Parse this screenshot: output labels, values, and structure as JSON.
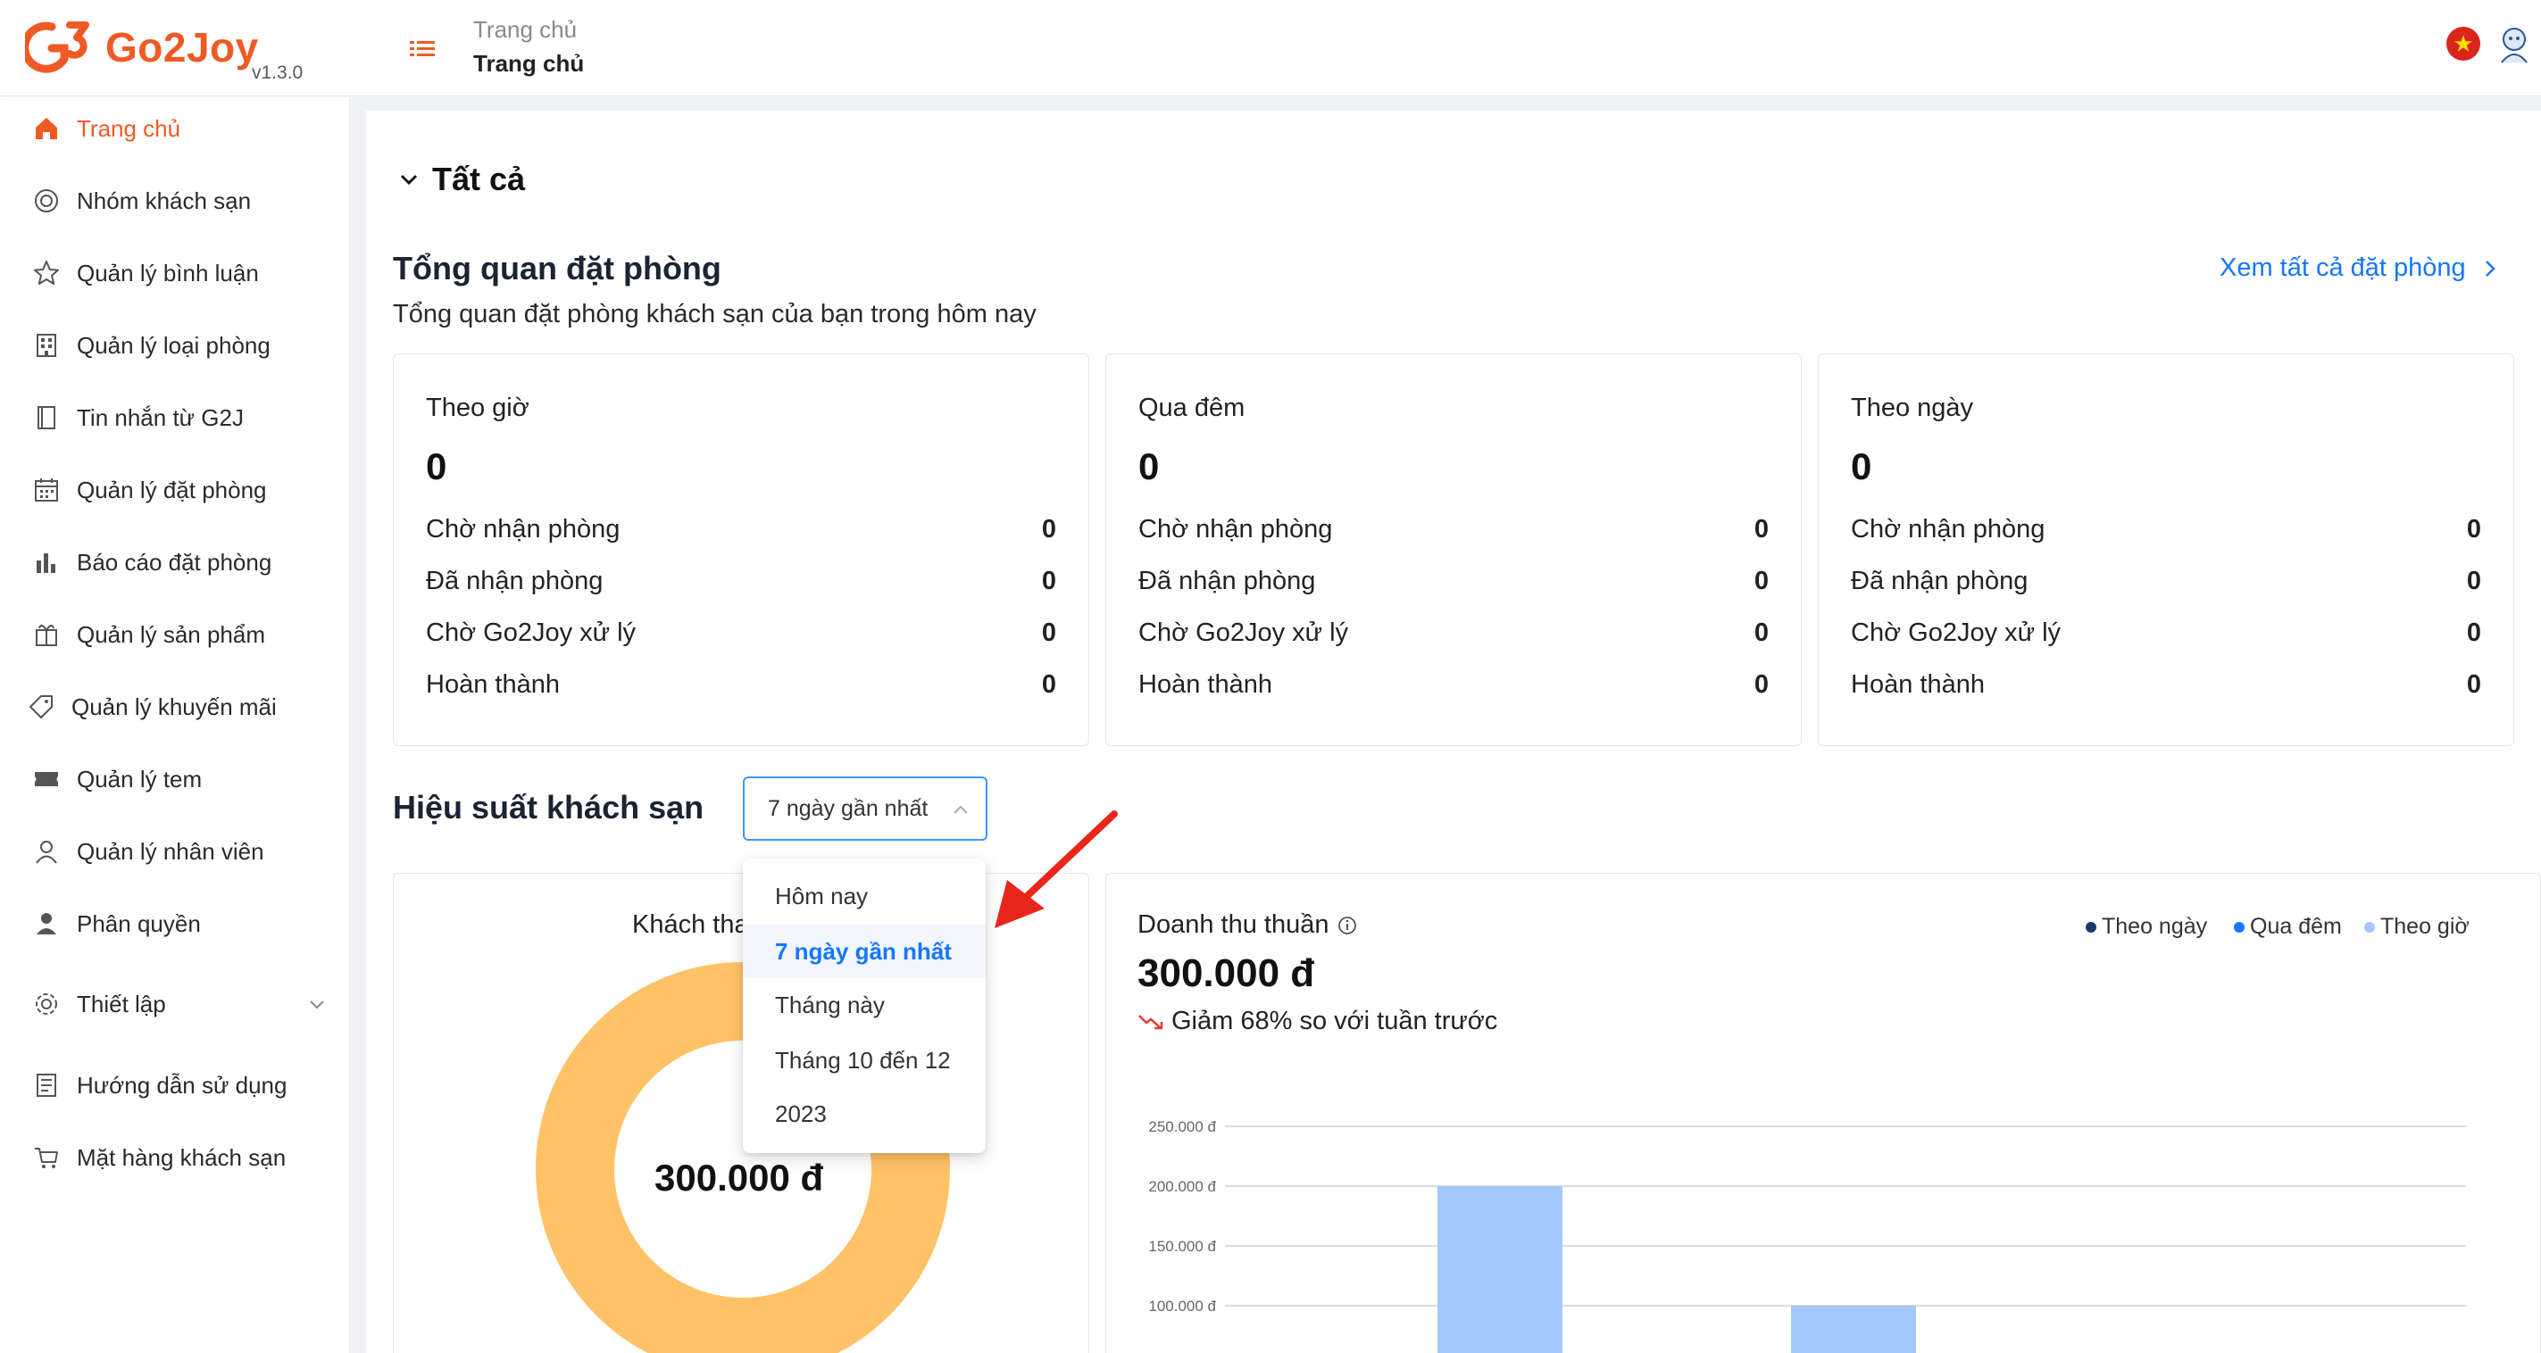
{
  "header": {
    "brand": "Go2Joy",
    "version": "v1.3.0",
    "breadcrumb_parent": "Trang chủ",
    "breadcrumb_current": "Trang chủ",
    "icons": [
      "go2joy-logo",
      "menu-toggle-icon",
      "vietnam-flag-icon",
      "user-avatar-icon"
    ]
  },
  "sidebar": {
    "items": [
      {
        "label": "Trang chủ",
        "icon": "home-icon",
        "active": true
      },
      {
        "label": "Nhóm khách sạn",
        "icon": "hotel-group-icon"
      },
      {
        "label": "Quản lý bình luận",
        "icon": "star-icon"
      },
      {
        "label": "Quản lý loại phòng",
        "icon": "building-icon"
      },
      {
        "label": "Tin nhắn từ G2J",
        "icon": "message-book-icon"
      },
      {
        "label": "Quản lý đặt phòng",
        "icon": "calendar-icon"
      },
      {
        "label": "Báo cáo đặt phòng",
        "icon": "bar-chart-icon"
      },
      {
        "label": "Quản lý sản phẩm",
        "icon": "gift-box-icon"
      },
      {
        "label": "Quản lý khuyến mãi",
        "icon": "tag-icon"
      },
      {
        "label": "Quản lý tem",
        "icon": "stamp-icon"
      },
      {
        "label": "Quản lý nhân viên",
        "icon": "user-icon"
      },
      {
        "label": "Phân quyền",
        "icon": "permission-icon"
      },
      {
        "label": "Thiết lập",
        "icon": "gear-icon"
      },
      {
        "label": "Hướng dẫn sử dụng",
        "icon": "guide-icon"
      },
      {
        "label": "Mặt hàng khách sạn",
        "icon": "cart-icon"
      }
    ]
  },
  "main": {
    "section_label": "Tất cả",
    "overview": {
      "title": "Tổng quan đặt phòng",
      "subtitle": "Tổng quan đặt phòng khách sạn của bạn trong hôm nay",
      "view_all": "Xem tất cả đặt phòng"
    },
    "cards": [
      {
        "title": "Theo giờ",
        "total": "0",
        "rows": [
          {
            "label": "Chờ nhận phòng",
            "value": "0"
          },
          {
            "label": "Đã nhận phòng",
            "value": "0"
          },
          {
            "label": "Chờ Go2Joy xử lý",
            "value": "0"
          },
          {
            "label": "Hoàn thành",
            "value": "0"
          }
        ]
      },
      {
        "title": "Qua đêm",
        "total": "0",
        "rows": [
          {
            "label": "Chờ nhận phòng",
            "value": "0"
          },
          {
            "label": "Đã nhận phòng",
            "value": "0"
          },
          {
            "label": "Chờ Go2Joy xử lý",
            "value": "0"
          },
          {
            "label": "Hoàn thành",
            "value": "0"
          }
        ]
      },
      {
        "title": "Theo ngày",
        "total": "0",
        "rows": [
          {
            "label": "Chờ nhận phòng",
            "value": "0"
          },
          {
            "label": "Đã nhận phòng",
            "value": "0"
          },
          {
            "label": "Chờ Go2Joy xử lý",
            "value": "0"
          },
          {
            "label": "Hoàn thành",
            "value": "0"
          }
        ]
      }
    ],
    "performance": {
      "title": "Hiệu suất khách sạn",
      "period_selected": "7 ngày gần nhất",
      "period_options": [
        "Hôm nay",
        "7 ngày gần nhất",
        "Tháng này",
        "Tháng 10 đến 12",
        "2023"
      ],
      "donut_title": "Khách thanh toán",
      "donut_value": "300.000 đ",
      "donut_color": "#ffc266",
      "revenue": {
        "title": "Doanh thu thuần",
        "value": "300.000 đ",
        "change_text": "Giảm 68% so với tuần trước",
        "change_color": "#e53935"
      }
    }
  },
  "chart_data": {
    "type": "bar",
    "legend": [
      {
        "name": "Theo ngày",
        "color": "#1a3a6b"
      },
      {
        "name": "Qua đêm",
        "color": "#1677ff"
      },
      {
        "name": "Theo giờ",
        "color": "#a3c8fb"
      }
    ],
    "y_ticks": [
      "250.000 đ",
      "200.000 đ",
      "150.000 đ",
      "100.000 đ"
    ],
    "ylim": [
      0,
      250000
    ],
    "series": [
      {
        "name": "Theo giờ",
        "values": [
          200000,
          100000
        ]
      }
    ],
    "grid": true,
    "legend_position": "top-right"
  },
  "annotation": {
    "arrow_color": "#e8261a"
  }
}
